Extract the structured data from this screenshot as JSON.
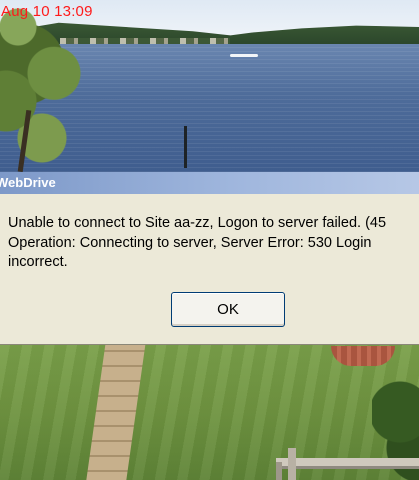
{
  "webcam": {
    "timestamp": "Aug 10 13:09"
  },
  "dialog": {
    "title": "WebDrive",
    "message_lines": [
      "Unable to connect to Site aa-zz, Logon to server failed. (45",
      "Operation: Connecting to server, Server Error: 530 Login",
      "incorrect."
    ],
    "ok_label": "OK"
  },
  "colors": {
    "timestamp": "#ff1a1a",
    "title_bar": "#7c98c8",
    "dialog_background": "#ece9d8"
  }
}
